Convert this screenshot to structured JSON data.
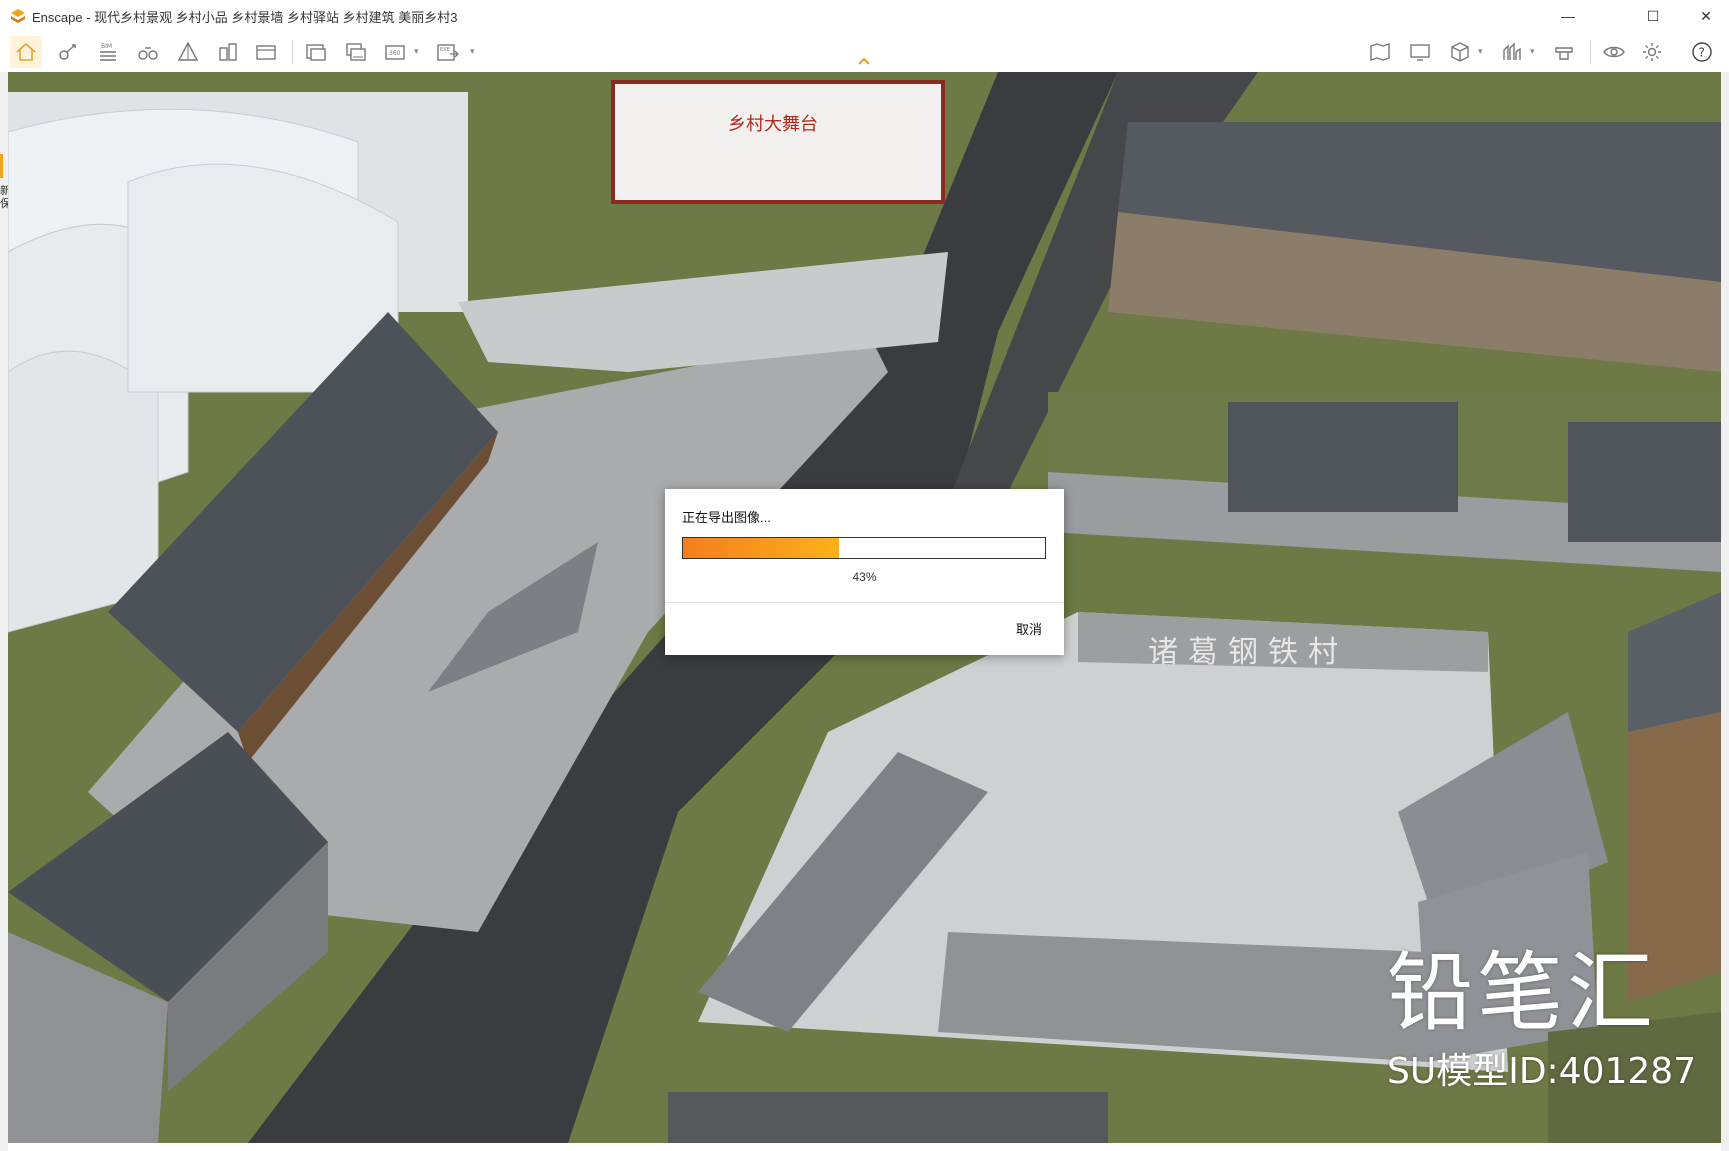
{
  "window": {
    "title": "Enscape - 现代乡村景观 乡村小品 乡村景墙 乡村驿站 乡村建筑 美丽乡村3",
    "minimize_glyph": "—",
    "maximize_glyph": "☐",
    "close_glyph": "✕"
  },
  "toolbar": {
    "left_icons": [
      "home-icon",
      "view-tools-icon",
      "bim-icon",
      "binoculars-icon",
      "perspective-icon",
      "buildings-icon",
      "sync-views-icon",
      "screenshot-icon",
      "batch-render-icon",
      "panorama-360-icon",
      "export-exe-icon"
    ],
    "right_icons": [
      "map-view-icon",
      "monitor-icon",
      "cube-asset-icon",
      "atmosphere-icon",
      "material-editor-icon",
      "visual-settings-icon",
      "settings-gear-icon",
      "help-icon"
    ],
    "bim_label": "BIM",
    "exe_label": "EXE",
    "pano_label": "360",
    "help_label": "?"
  },
  "left_strip_text": "新\n保",
  "scene_texts": {
    "stage_sign": "乡村大舞台",
    "village_wall": "诸葛钢铁村"
  },
  "export_dialog": {
    "title": "正在导出图像...",
    "progress_percent": 43,
    "progress_text": "43%",
    "cancel_label": "取消",
    "accent_start": "#f57e1e",
    "accent_end": "#fbb11a"
  },
  "watermark": {
    "brand": "铅笔汇",
    "model_id": "SU模型ID:401287"
  }
}
